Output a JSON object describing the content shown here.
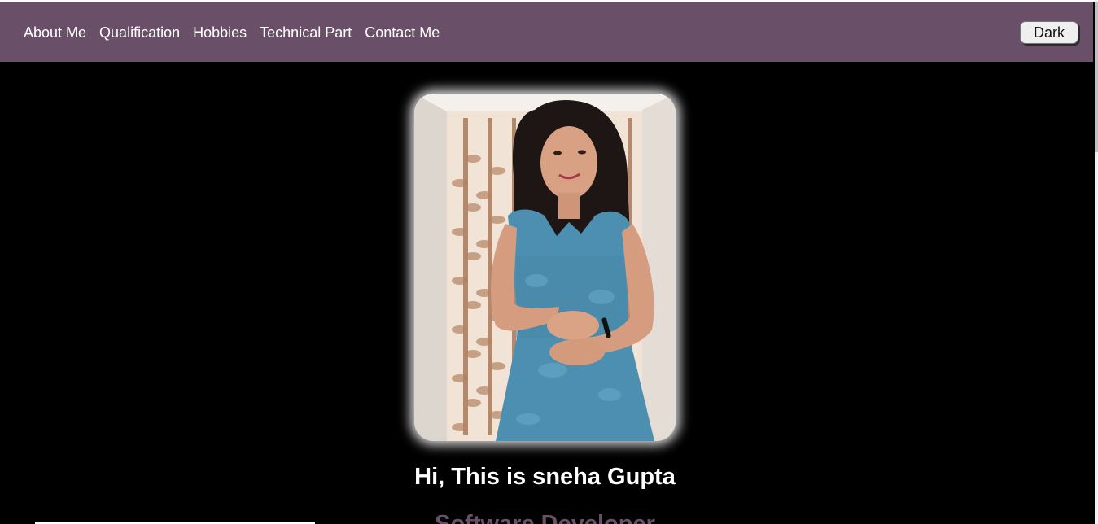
{
  "nav": {
    "links": [
      "About Me",
      "Qualification",
      "Hobbies",
      "Technical Part",
      "Contact Me"
    ],
    "theme_button": "Dark"
  },
  "hero": {
    "greeting": "Hi, This is sneha Gupta",
    "role": "Software Developer",
    "photo_icon": "profile-photo"
  },
  "colors": {
    "nav_bg": "#6a4f68",
    "page_bg": "#000000",
    "accent_text": "#6a4f68"
  }
}
